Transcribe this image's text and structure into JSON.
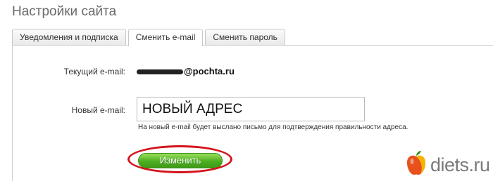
{
  "page": {
    "title": "Настройки сайта"
  },
  "tabs": [
    {
      "label": "Уведомления и подписка",
      "active": false
    },
    {
      "label": "Сменить e-mail",
      "active": true
    },
    {
      "label": "Сменить пароль",
      "active": false
    }
  ],
  "form": {
    "current_label": "Текущий e-mail:",
    "current_value_domain": "@pochta.ru",
    "new_label": "Новый e-mail:",
    "new_value": "НОВЫЙ АДРЕС",
    "hint": "На новый e-mail будет выслано письмо для подтверждения правильности адреса.",
    "submit_label": "Изменить"
  },
  "annotation": {
    "ring_color": "#d4141b"
  },
  "watermark": {
    "text": "diets.ru",
    "icon": "apple-icon"
  }
}
